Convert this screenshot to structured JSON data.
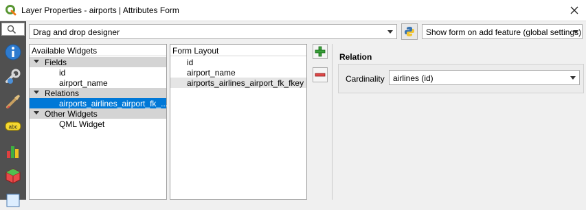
{
  "window": {
    "title": "Layer Properties - airports | Attributes Form"
  },
  "toolbar": {
    "designer_mode": "Drag and drop designer",
    "suppress_form": "Show form on add feature (global settings)"
  },
  "available_widgets": {
    "header": "Available Widgets",
    "groups": [
      {
        "label": "Fields",
        "items": [
          "id",
          "airport_name"
        ]
      },
      {
        "label": "Relations",
        "items": [
          "airports_airlines_airport_fk_..."
        ]
      },
      {
        "label": "Other Widgets",
        "items": [
          "QML Widget"
        ]
      }
    ]
  },
  "form_layout": {
    "header": "Form Layout",
    "items": [
      "id",
      "airport_name",
      "airports_airlines_airport_fk_fkey"
    ]
  },
  "relation": {
    "title": "Relation",
    "cardinality_label": "Cardinality",
    "cardinality_value": "airlines (id)"
  },
  "icons": [
    "qgis-logo-icon",
    "close-icon",
    "search-icon",
    "information-icon",
    "source-settings-icon",
    "symbology-icon",
    "labels-icon",
    "diagrams-icon",
    "3d-view-icon",
    "fields-icon",
    "python-icon",
    "add-icon",
    "remove-icon"
  ],
  "colors": {
    "selection": "#0078d7",
    "sidebar": "#505050",
    "group_bg": "#d4d4d4"
  }
}
